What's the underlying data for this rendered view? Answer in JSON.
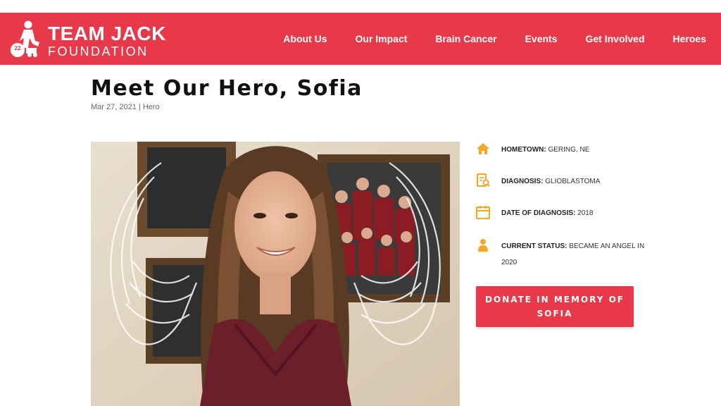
{
  "header": {
    "logo_line1": "TEAM JACK",
    "logo_line2": "FOUNDATION",
    "logo_badge": "22",
    "nav": [
      {
        "label": "About Us"
      },
      {
        "label": "Our Impact"
      },
      {
        "label": "Brain Cancer"
      },
      {
        "label": "Events"
      },
      {
        "label": "Get Involved"
      },
      {
        "label": "Heroes"
      }
    ]
  },
  "post": {
    "title": "Meet Our Hero, Sofia",
    "date": "Mar 27, 2021",
    "separator": " | ",
    "category": "Hero"
  },
  "info": [
    {
      "icon": "home-icon",
      "label": "HOMETOWN:",
      "value": "GERING, NE"
    },
    {
      "icon": "diagnosis-icon",
      "label": "DIAGNOSIS:",
      "value": "GLIOBLASTOMA"
    },
    {
      "icon": "calendar-icon",
      "label": "DATE OF DIAGNOSIS:",
      "value": "2018"
    },
    {
      "icon": "person-icon",
      "label": "CURRENT STATUS:",
      "value": "BECAME AN ANGEL IN 2020"
    }
  ],
  "donate": {
    "line1": "DONATE IN MEMORY OF",
    "line2": "SOFIA"
  },
  "colors": {
    "brand": "#e8394a",
    "icon_accent": "#f5a623"
  }
}
